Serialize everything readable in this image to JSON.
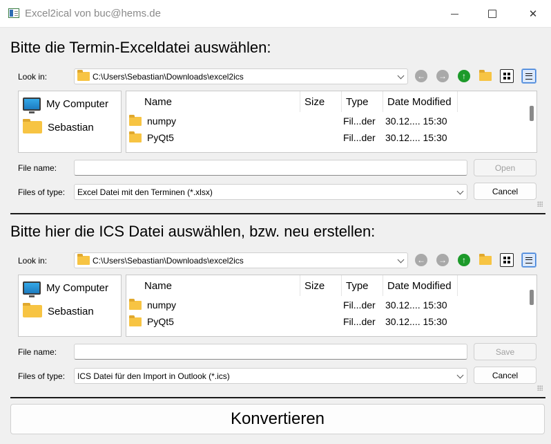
{
  "window": {
    "title": "Excel2ical von buc@hems.de",
    "close_glyph": "✕"
  },
  "colors": {
    "accent": "#3b7fd8",
    "folder": "#f7c443",
    "up_arrow": "#1d9a2a"
  },
  "dialogs": [
    {
      "heading": "Bitte die Termin-Exceldatei auswählen:",
      "look_in_label": "Look in:",
      "look_in_path": "C:\\Users\\Sebastian\\Downloads\\excel2ics",
      "sidebar": [
        {
          "label": "My Computer",
          "icon": "monitor-icon"
        },
        {
          "label": "Sebastian",
          "icon": "folder-icon"
        }
      ],
      "columns": [
        "Name",
        "Size",
        "Type",
        "Date Modified"
      ],
      "files": [
        {
          "name": "numpy",
          "type": "Fil...der",
          "date": "30.12.... 15:30"
        },
        {
          "name": "PyQt5",
          "type": "Fil...der",
          "date": "30.12.... 15:30"
        }
      ],
      "file_name_label": "File name:",
      "file_name_value": "",
      "action_button": "Open",
      "files_of_type_label": "Files of type:",
      "files_of_type_value": "Excel Datei mit den Terminen (*.xlsx)",
      "cancel_button": "Cancel"
    },
    {
      "heading": "Bitte hier die ICS Datei auswählen, bzw. neu erstellen:",
      "look_in_label": "Look in:",
      "look_in_path": "C:\\Users\\Sebastian\\Downloads\\excel2ics",
      "sidebar": [
        {
          "label": "My Computer",
          "icon": "monitor-icon"
        },
        {
          "label": "Sebastian",
          "icon": "folder-icon"
        }
      ],
      "columns": [
        "Name",
        "Size",
        "Type",
        "Date Modified"
      ],
      "files": [
        {
          "name": "numpy",
          "type": "Fil...der",
          "date": "30.12.... 15:30"
        },
        {
          "name": "PyQt5",
          "type": "Fil...der",
          "date": "30.12.... 15:30"
        }
      ],
      "file_name_label": "File name:",
      "file_name_value": "",
      "action_button": "Save",
      "files_of_type_label": "Files of type:",
      "files_of_type_value": "ICS Datei für den Import in Outlook (*.ics)",
      "cancel_button": "Cancel"
    }
  ],
  "convert_button": "Konvertieren"
}
